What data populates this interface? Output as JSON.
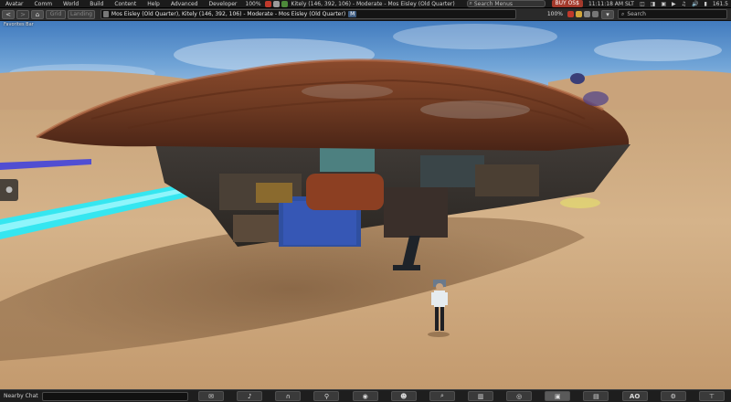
{
  "menu": {
    "items": [
      "Avatar",
      "Comm",
      "World",
      "Build",
      "Content",
      "Help",
      "Advanced",
      "Developer"
    ],
    "volume": "100%",
    "parcel_text": "Kitely (146, 392, 106) - Moderate - Mos Eisley (Old Quarter)",
    "search_placeholder": "Search Menus",
    "buy_label": "BUY OS$",
    "time": "11:11:18 AM SLT",
    "fps": "161.5",
    "icons": [
      "voice-icon",
      "sound-icon",
      "media-icon",
      "play-icon",
      "music-icon",
      "speaker-icon",
      "network-icon"
    ]
  },
  "nav": {
    "back": "<",
    "forward": ">",
    "home_icon": "home-icon",
    "grid_label": "Grid",
    "landing_label": "Landing",
    "location": "Mos Eisley (Old Quarter), Kitely (146, 392, 106) - Moderate - Mos Eisley (Old Quarter)",
    "rating": "M",
    "zoom": "100%",
    "search_placeholder": "Search"
  },
  "favorites_label": "Favorites Bar",
  "side_tab_icon": "pin-icon",
  "bottom": {
    "chat_label": "Nearby Chat",
    "tools": [
      {
        "name": "chat-tool",
        "glyph": "💬"
      },
      {
        "name": "voice-tool",
        "glyph": "🎤"
      },
      {
        "name": "speak-tool",
        "glyph": "🎧"
      },
      {
        "name": "move-tool",
        "glyph": "🚶"
      },
      {
        "name": "view-tool",
        "glyph": "👁"
      },
      {
        "name": "people-tool",
        "glyph": "👥"
      },
      {
        "name": "search-tool",
        "glyph": "🔍"
      },
      {
        "name": "map-tool",
        "glyph": "🗺"
      },
      {
        "name": "minimap-tool",
        "glyph": "◎"
      },
      {
        "name": "snapshot-tool",
        "glyph": "📷"
      },
      {
        "name": "inventory-tool",
        "glyph": "🧳"
      },
      {
        "name": "ao-tool",
        "glyph": "AO"
      },
      {
        "name": "settings-tool",
        "glyph": "⚙"
      },
      {
        "name": "appearance-tool",
        "glyph": "👕"
      }
    ]
  }
}
